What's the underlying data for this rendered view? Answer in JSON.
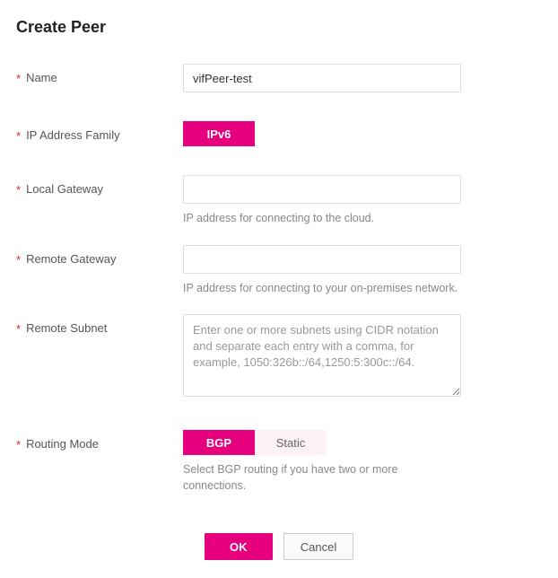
{
  "title": "Create Peer",
  "fields": {
    "name": {
      "label": "Name",
      "value": "vifPeer-test"
    },
    "ipFamily": {
      "label": "IP Address Family",
      "selected": "IPv6"
    },
    "localGateway": {
      "label": "Local Gateway",
      "value": "",
      "help": "IP address for connecting to the cloud."
    },
    "remoteGateway": {
      "label": "Remote Gateway",
      "value": "",
      "help": "IP address for connecting to your on-premises network."
    },
    "remoteSubnet": {
      "label": "Remote Subnet",
      "value": "",
      "placeholder": "Enter one or more subnets using CIDR notation and separate each entry with a comma, for example, 1050:326b::/64,1250:5:300c::/64."
    },
    "routingMode": {
      "label": "Routing Mode",
      "options": {
        "bgp": "BGP",
        "static": "Static"
      },
      "help": "Select BGP routing if you have two or more connections."
    }
  },
  "footer": {
    "ok": "OK",
    "cancel": "Cancel"
  },
  "asterisk": "*"
}
